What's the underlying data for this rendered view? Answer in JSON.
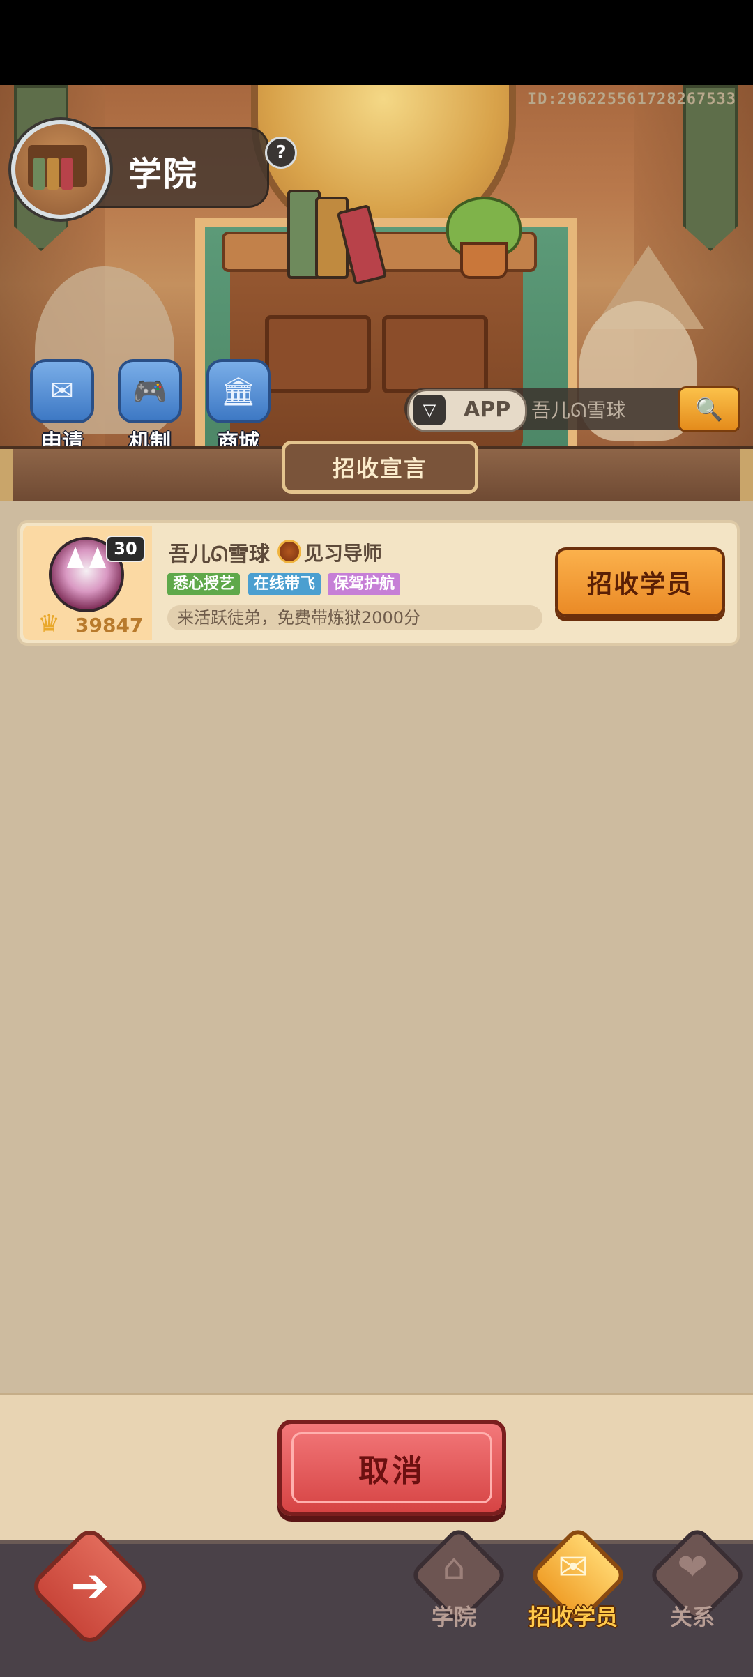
{
  "header": {
    "id_text": "ID:2962255617282​67533",
    "title": "学院",
    "help_label": "?"
  },
  "quick_actions": [
    {
      "label": "申请",
      "icon": "envelope-feather-icon"
    },
    {
      "label": "机制",
      "icon": "gamepad-icon"
    },
    {
      "label": "商城",
      "icon": "shop-icon"
    }
  ],
  "search": {
    "platform": "APP",
    "value": "吾儿ᘏ雪球",
    "placeholder": ""
  },
  "section": {
    "title": "招收宣言"
  },
  "card": {
    "level": "30",
    "score": "39847",
    "name": "吾儿ᘏ雪球",
    "rank": "见习导师",
    "tags": [
      "悉心授艺",
      "在线带飞",
      "保驾护航"
    ],
    "motto": "来活跃徒弟，免费带炼狱2000分",
    "action_label": "招收学员"
  },
  "footer": {
    "cancel_label": "取消"
  },
  "bottom_nav": {
    "back_icon": "back-arrow-icon",
    "items": [
      {
        "label": "学院",
        "active": false
      },
      {
        "label": "招收学员",
        "active": true
      },
      {
        "label": "关系",
        "active": false
      }
    ]
  }
}
